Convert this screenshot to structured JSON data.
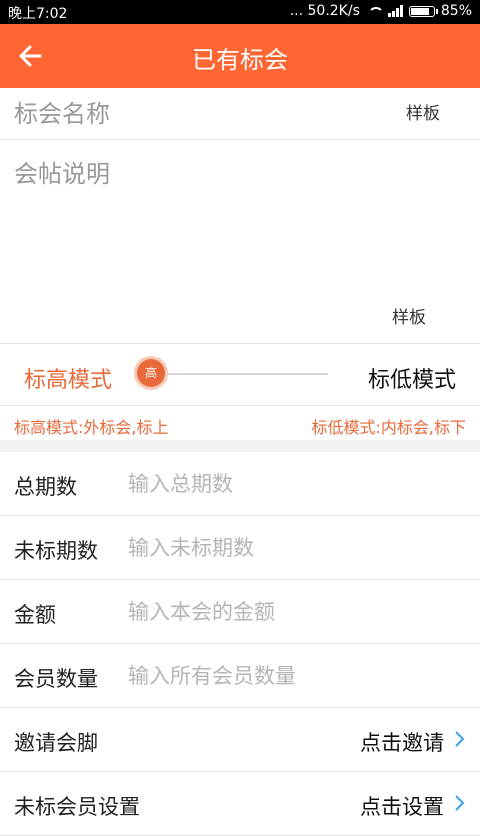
{
  "status": {
    "time": "晚上7:02",
    "speed": "... 50.2K/s",
    "battery": "85%",
    "battery_level": 0.85
  },
  "header": {
    "title": "已有标会"
  },
  "meeting": {
    "name_placeholder": "标会名称",
    "template_label": "样板",
    "desc_placeholder": "会帖说明",
    "desc_template_label": "样板"
  },
  "mode": {
    "high_label": "标高模式",
    "knob_label": "高",
    "low_label": "标低模式",
    "high_desc": "标高模式:外标会,标上",
    "low_desc": "标低模式:内标会,标下"
  },
  "form": [
    {
      "label": "总期数",
      "placeholder": "输入总期数"
    },
    {
      "label": "未标期数",
      "placeholder": "输入未标期数"
    },
    {
      "label": "金额",
      "placeholder": "输入本会的金额"
    },
    {
      "label": "会员数量",
      "placeholder": "输入所有会员数量"
    }
  ],
  "invite": {
    "label": "邀请会脚",
    "action": "点击邀请"
  },
  "unmarked": {
    "label": "未标会员设置",
    "action": "点击设置"
  },
  "colors": {
    "accent": "#FF6633",
    "mode_text": "#E8693A"
  }
}
